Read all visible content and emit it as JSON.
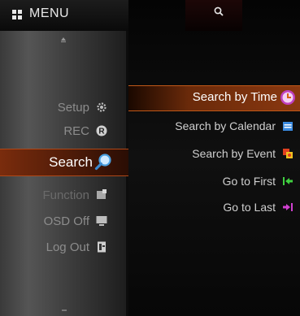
{
  "menu": {
    "title": "MENU",
    "items": [
      {
        "label": "Setup",
        "icon": "gear-icon",
        "active": false
      },
      {
        "label": "REC",
        "icon": "record-icon",
        "active": false
      },
      {
        "label": "Search",
        "icon": "magnifier-icon",
        "active": true
      },
      {
        "label": "Function",
        "icon": "function-icon",
        "active": false
      },
      {
        "label": "OSD Off",
        "icon": "monitor-icon",
        "active": false
      },
      {
        "label": "Log Out",
        "icon": "logout-icon",
        "active": false
      }
    ]
  },
  "submenu": {
    "items": [
      {
        "label": "Search by Time",
        "icon": "clock-icon",
        "active": true
      },
      {
        "label": "Search by Calendar",
        "icon": "calendar-icon",
        "active": false
      },
      {
        "label": "Search by Event",
        "icon": "event-icon",
        "active": false
      },
      {
        "label": "Go to First",
        "icon": "go-first-icon",
        "active": false
      },
      {
        "label": "Go to Last",
        "icon": "go-last-icon",
        "active": false
      }
    ]
  },
  "colors": {
    "accent_orange": "#b04818",
    "active_text": "#ffffff",
    "inactive_text": "#8c8c8c",
    "submenu_text": "#cfcfcf"
  }
}
